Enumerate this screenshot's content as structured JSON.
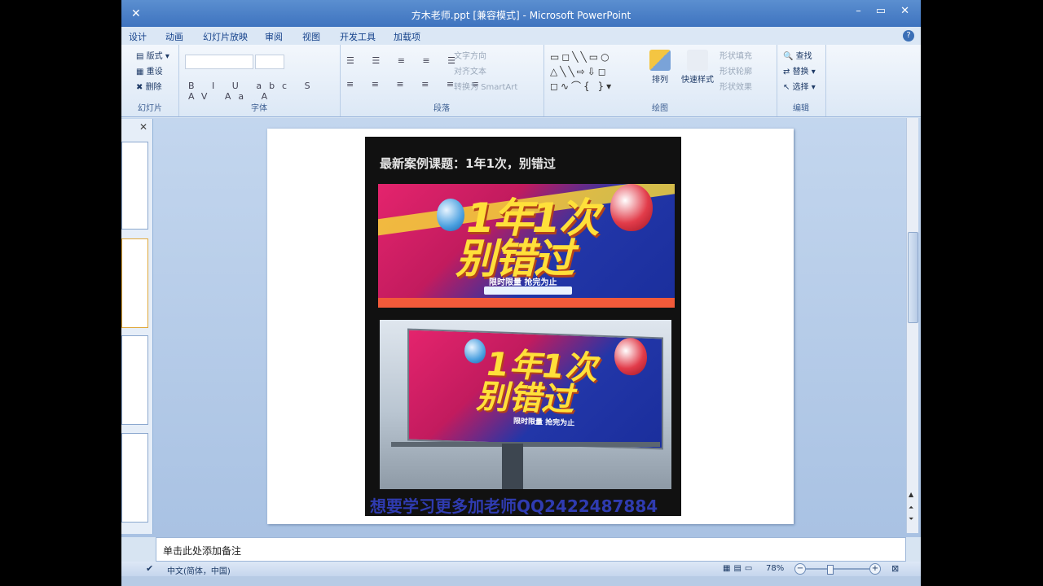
{
  "window": {
    "title": "方木老师.ppt [兼容模式] - Microsoft PowerPoint",
    "close_x": "✕",
    "minimize": "–",
    "restore": "▭",
    "close": "✕"
  },
  "menu": {
    "items": [
      "设计",
      "动画",
      "幻灯片放映",
      "审阅",
      "视图",
      "开发工具",
      "加载项"
    ],
    "help": "?"
  },
  "ribbon": {
    "slides_group": {
      "label": "幻灯片",
      "layout": "版式",
      "reset": "重设",
      "delete": "删除"
    },
    "font_group": {
      "label": "字体",
      "format_row": "B I U abc S AV Aa A"
    },
    "paragraph_group": {
      "label": "段落",
      "text_direction": "文字方向",
      "align_text": "对齐文本",
      "smartart": "转换为 SmartArt"
    },
    "drawing_group": {
      "label": "绘图",
      "arrange": "排列",
      "quick_styles": "快速样式",
      "fill": "形状填充",
      "outline": "形状轮廓",
      "effects": "形状效果"
    },
    "editing_group": {
      "label": "编辑",
      "find": "查找",
      "replace": "替换",
      "select": "选择"
    }
  },
  "slide": {
    "poster_title": "最新案例课题：1年1次，别错过",
    "banner_line1": "1年1次",
    "banner_line2": "别错过",
    "banner_sub": "限时限量  抢完为止",
    "billboard_line1": "1年1次",
    "billboard_line2": "别错过",
    "billboard_sub": "限时限量  抢完为止",
    "bottom_text": "想要学习更多加老师QQ2422487884"
  },
  "notes": {
    "placeholder": "单击此处添加备注"
  },
  "status": {
    "language": "中文(简体，中国)",
    "zoom": "78%"
  },
  "colors": {
    "title_bar": "#3e73bf",
    "ribbon": "#dce8f6",
    "banner_pink": "#e4246d",
    "banner_blue": "#1a2e9c",
    "headline_yellow": "#ffe03a"
  }
}
